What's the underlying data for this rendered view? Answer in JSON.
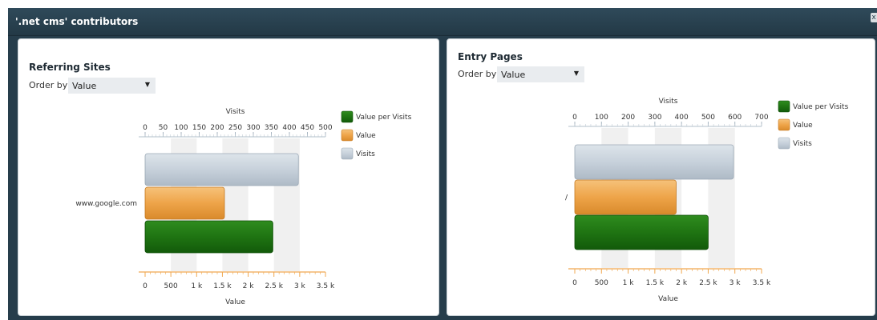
{
  "window": {
    "title": "'.net cms' contributors",
    "close_label": "x"
  },
  "panels": [
    {
      "title": "Referring Sites",
      "order_by_label": "Order by",
      "order_by_value": "Value"
    },
    {
      "title": "Entry Pages",
      "order_by_label": "Order by",
      "order_by_value": "Value"
    }
  ],
  "chart_data": [
    {
      "type": "bar",
      "title": "",
      "categories": [
        "www.google.com"
      ],
      "series": [
        {
          "name": "Visits",
          "axis": "top",
          "values": [
            425
          ],
          "color": "#c3ced9"
        },
        {
          "name": "Value",
          "axis": "bottom",
          "values": [
            1540
          ],
          "color": "#f0a850"
        },
        {
          "name": "Value per Visits",
          "axis": "bottom",
          "values": [
            2480
          ],
          "color": "#1f7a12"
        }
      ],
      "top_axis": {
        "label": "Visits",
        "ticks": [
          "0",
          "50",
          "100",
          "150",
          "200",
          "250",
          "300",
          "350",
          "400",
          "450",
          "500"
        ],
        "range": [
          0,
          500
        ]
      },
      "bottom_axis": {
        "label": "Value",
        "ticks": [
          "0",
          "500",
          "1 k",
          "1.5 k",
          "2 k",
          "2.5 k",
          "3 k",
          "3.5 k"
        ],
        "range": [
          0,
          3500
        ]
      },
      "legend": [
        {
          "name": "Value per Visits",
          "color": "#1f7a12"
        },
        {
          "name": "Value",
          "color": "#f0a850"
        },
        {
          "name": "Visits",
          "color": "#c3ced9"
        }
      ]
    },
    {
      "type": "bar",
      "title": "",
      "categories": [
        "/"
      ],
      "series": [
        {
          "name": "Visits",
          "axis": "top",
          "values": [
            595
          ],
          "color": "#c3ced9"
        },
        {
          "name": "Value",
          "axis": "bottom",
          "values": [
            1900
          ],
          "color": "#f0a850"
        },
        {
          "name": "Value per Visits",
          "axis": "bottom",
          "values": [
            2500
          ],
          "color": "#1f7a12"
        }
      ],
      "top_axis": {
        "label": "Visits",
        "ticks": [
          "0",
          "100",
          "200",
          "300",
          "400",
          "500",
          "600",
          "700"
        ],
        "range": [
          0,
          700
        ]
      },
      "bottom_axis": {
        "label": "Value",
        "ticks": [
          "0",
          "500",
          "1 k",
          "1.5 k",
          "2 k",
          "2.5 k",
          "3 k",
          "3.5 k"
        ],
        "range": [
          0,
          3500
        ]
      },
      "legend": [
        {
          "name": "Value per Visits",
          "color": "#1f7a12"
        },
        {
          "name": "Value",
          "color": "#f0a850"
        },
        {
          "name": "Visits",
          "color": "#c3ced9"
        }
      ]
    }
  ]
}
